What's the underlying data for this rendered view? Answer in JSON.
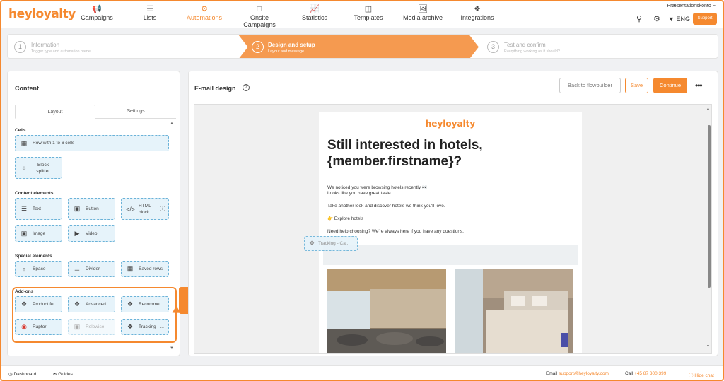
{
  "brand": {
    "logo": "heyloyalty",
    "accent": "#f5892f"
  },
  "nav": {
    "items": [
      {
        "label": "Campaigns",
        "icon": "megaphone-icon"
      },
      {
        "label": "Lists",
        "icon": "list-icon"
      },
      {
        "label": "Automations",
        "icon": "automation-icon",
        "active": true
      },
      {
        "label": "Onsite Campaigns",
        "icon": "onsite-icon"
      },
      {
        "label": "Statistics",
        "icon": "statistics-icon"
      },
      {
        "label": "Templates",
        "icon": "templates-icon"
      },
      {
        "label": "Media archive",
        "icon": "image-icon"
      },
      {
        "label": "Integrations",
        "icon": "integrations-icon"
      }
    ],
    "account": "Præsentationskonto F",
    "language": "ENG",
    "support": "Support"
  },
  "stepper": [
    {
      "num": "1",
      "title": "Information",
      "sub": "Trigger type and automation name"
    },
    {
      "num": "2",
      "title": "Design and setup",
      "sub": "Layout and message",
      "active": true
    },
    {
      "num": "3",
      "title": "Test and confirm",
      "sub": "Everything working as it should?"
    }
  ],
  "left": {
    "title": "Content",
    "tabs": [
      "Layout",
      "Settings"
    ],
    "sections": {
      "cells": "Cells",
      "content": "Content elements",
      "special": "Special elements",
      "addons": "Add-ons"
    },
    "cells": [
      "Row with 1 to 6 cells",
      "Block splitter"
    ],
    "content_elements": [
      "Text",
      "Button",
      "HTML block",
      "Image",
      "Video"
    ],
    "special_elements": [
      "Space",
      "Divider",
      "Saved rows"
    ],
    "addons": [
      "Product fe...",
      "Advanced ...",
      "Recomme...",
      "Raptor",
      "Relewise",
      "Tracking - ..."
    ]
  },
  "right": {
    "title": "E-mail design",
    "back": "Back to flowbuilder",
    "save": "Save",
    "continue": "Continue"
  },
  "email": {
    "logo": "heyloyalty",
    "heading": "Still interested in hotels, {member.firstname}?",
    "p1": "We noticed you were browsing hotels recently 👀",
    "p2": "Looks like you have great taste.",
    "p3": "Take another look and discover hotels we think you'll love.",
    "p4": "👉 Explore hotels",
    "p5": "Need help choosing? We're always here if you have any questions.",
    "drag_label": "Tracking - Ca..."
  },
  "footer": {
    "dashboard": "Dashboard",
    "guides": "Guides",
    "email_label": "Email",
    "email": "support@heyloyalty.com",
    "call_label": "Call",
    "phone": "+45 87 300 399",
    "hide_chat": "Hide chat"
  }
}
